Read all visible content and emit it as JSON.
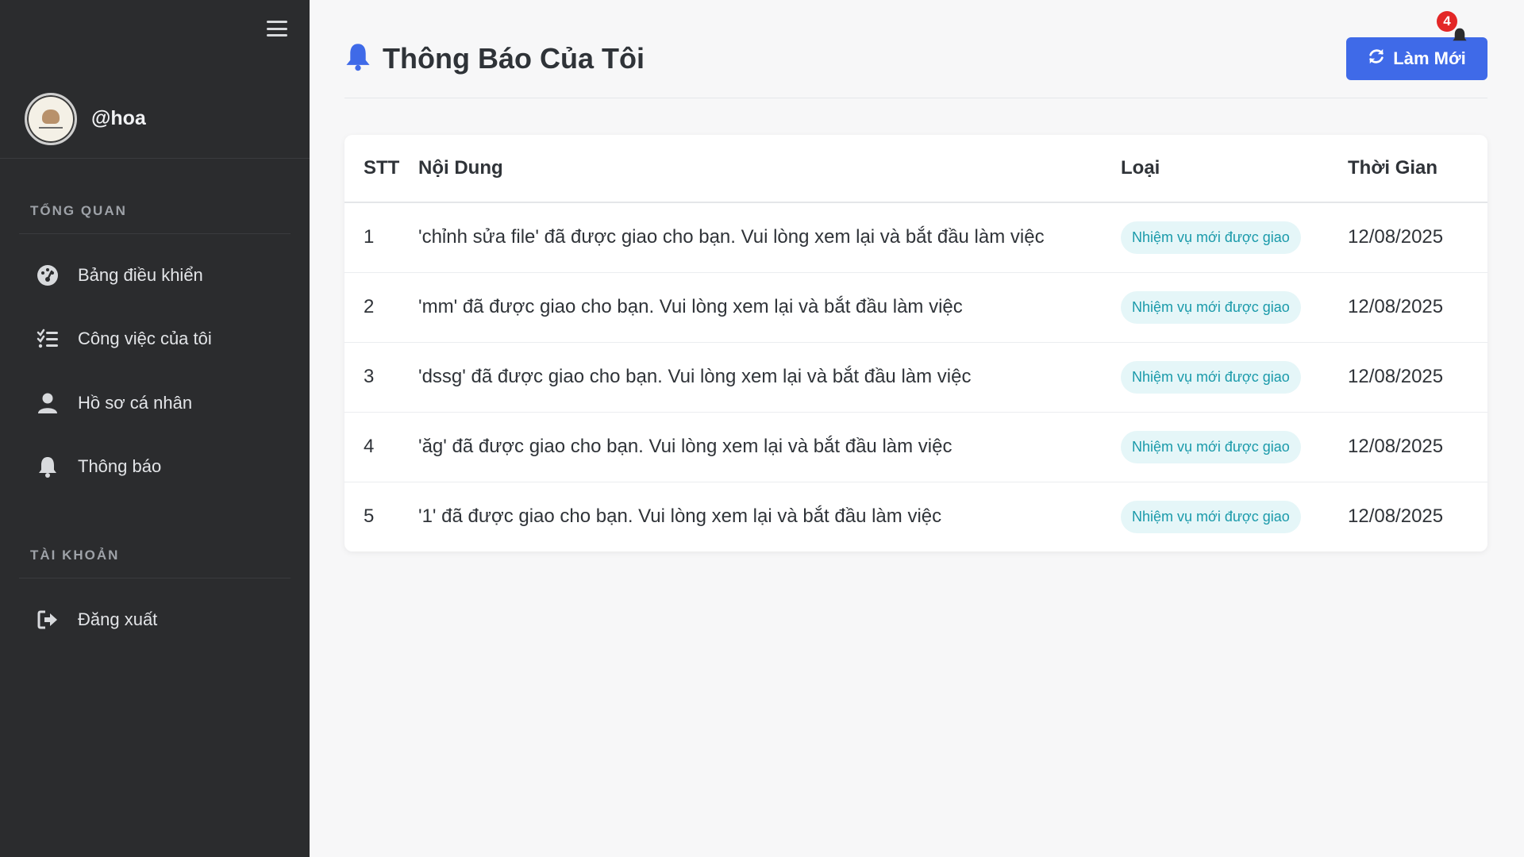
{
  "sidebar": {
    "username": "@hoa",
    "sections": {
      "overview": "TỔNG QUAN",
      "account": "TÀI KHOẢN"
    },
    "items": [
      {
        "label": "Bảng điều khiển",
        "icon": "dashboard-icon"
      },
      {
        "label": "Công việc của tôi",
        "icon": "tasks-icon"
      },
      {
        "label": "Hồ sơ cá nhân",
        "icon": "user-icon"
      },
      {
        "label": "Thông báo",
        "icon": "bell-icon"
      }
    ],
    "logout": {
      "label": "Đăng xuất",
      "icon": "logout-icon"
    }
  },
  "header": {
    "title": "Thông Báo Của Tôi",
    "refresh_label": "Làm Mới",
    "notification_count": "4"
  },
  "table": {
    "columns": [
      "STT",
      "Nội Dung",
      "Loại",
      "Thời Gian"
    ],
    "rows": [
      {
        "stt": "1",
        "content": "'chỉnh sửa file' đã được giao cho bạn. Vui lòng xem lại và bắt đầu làm việc",
        "type": "Nhiệm vụ mới được giao",
        "time": "12/08/2025"
      },
      {
        "stt": "2",
        "content": "'mm' đã được giao cho bạn. Vui lòng xem lại và bắt đầu làm việc",
        "type": "Nhiệm vụ mới được giao",
        "time": "12/08/2025"
      },
      {
        "stt": "3",
        "content": "'dssg' đã được giao cho bạn. Vui lòng xem lại và bắt đầu làm việc",
        "type": "Nhiệm vụ mới được giao",
        "time": "12/08/2025"
      },
      {
        "stt": "4",
        "content": "'ăg' đã được giao cho bạn. Vui lòng xem lại và bắt đầu làm việc",
        "type": "Nhiệm vụ mới được giao",
        "time": "12/08/2025"
      },
      {
        "stt": "5",
        "content": "'1' đã được giao cho bạn. Vui lòng xem lại và bắt đầu làm việc",
        "type": "Nhiệm vụ mới được giao",
        "time": "12/08/2025"
      }
    ]
  },
  "colors": {
    "sidebar_bg": "#2b2c2e",
    "accent": "#3f6ae8",
    "badge_bg": "#e5f6f8",
    "badge_text": "#1a9aaa",
    "notification_red": "#e32727"
  }
}
